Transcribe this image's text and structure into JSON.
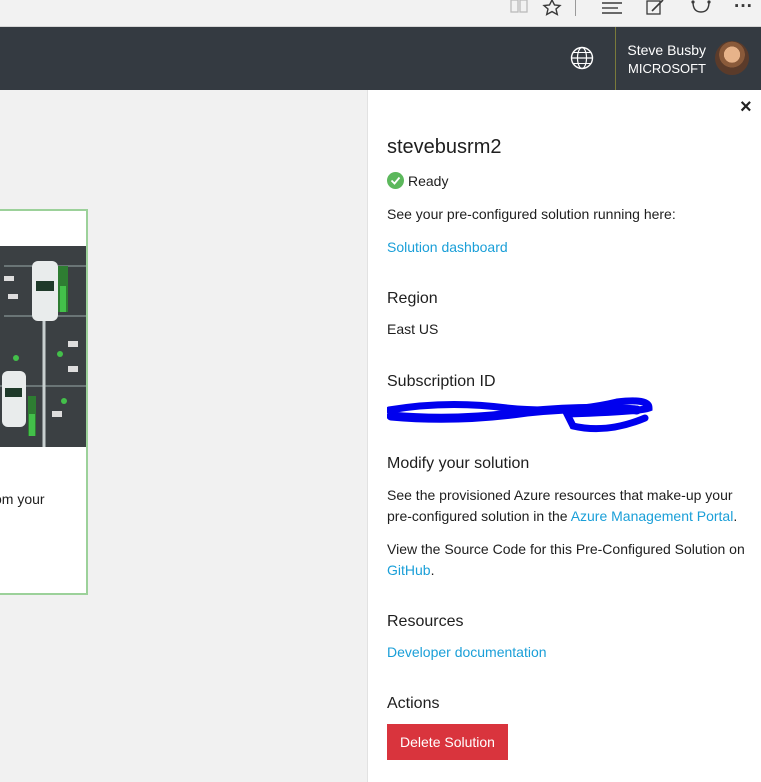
{
  "browser": {
    "icons": [
      "reading-view-icon",
      "favorite-star-icon",
      "hub-icon",
      "web-note-icon",
      "share-icon",
      "more-icon"
    ],
    "more_glyph": "···"
  },
  "header": {
    "user_name": "Steve Busby",
    "user_org": "MICROSOFT",
    "colors": {
      "background": "#343a41",
      "text": "#ffffff"
    }
  },
  "card": {
    "text_fragment": "om your",
    "border_color": "#9cd19a"
  },
  "panel": {
    "close_glyph": "×",
    "solution_name": "stevebusrm2",
    "status": "Ready",
    "intro": "See your pre-configured solution running here:",
    "dashboard_link": "Solution dashboard",
    "region_heading": "Region",
    "region_value": "East US",
    "subscription_heading": "Subscription ID",
    "modify_heading": "Modify your solution",
    "modify_line1": "See the provisioned Azure resources that make-up your",
    "modify_line2_prefix": "pre-configured solution in the ",
    "modify_link": "Azure Management Portal",
    "modify_line2_suffix": ".",
    "source_line1": "View the Source Code for this Pre-Configured Solution on",
    "github_link": "GitHub",
    "source_suffix": ".",
    "resources_heading": "Resources",
    "docs_link": "Developer documentation",
    "actions_heading": "Actions",
    "delete_button": "Delete Solution",
    "colors": {
      "link": "#1a9fd8",
      "status_ok": "#5cb85c",
      "danger": "#d9343d"
    }
  }
}
